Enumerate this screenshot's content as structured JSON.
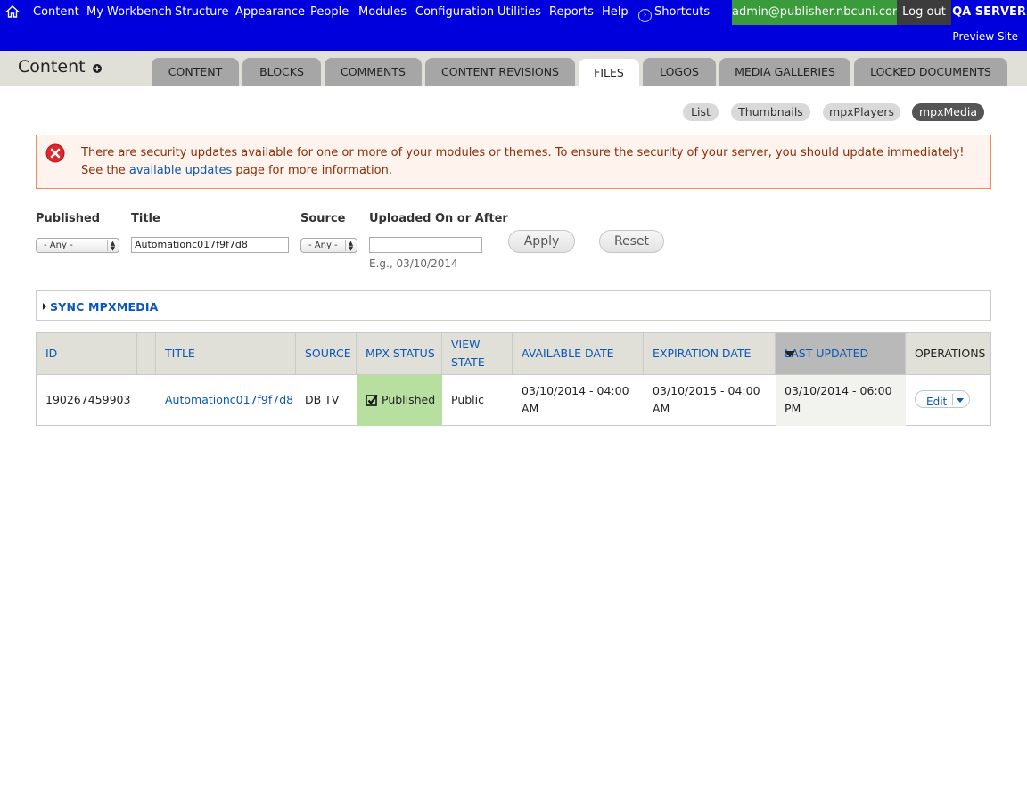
{
  "toolbar": {
    "menu": [
      "Content",
      "My Workbench",
      "Structure",
      "Appearance",
      "People",
      "Modules",
      "Configuration",
      "Utilities",
      "Reports",
      "Help"
    ],
    "shortcuts_label": "Shortcuts",
    "user": "admin@publisher.nbcuni.com",
    "logout": "Log out",
    "server": "QA SERVER",
    "preview_site": "Preview Site"
  },
  "page": {
    "title": "Content",
    "tabs": [
      "Content",
      "Blocks",
      "Comments",
      "Content Revisions",
      "Files",
      "Logos",
      "Media Galleries",
      "Locked Documents"
    ],
    "active_tab": "Files",
    "subtabs": [
      "List",
      "Thumbnails",
      "mpxPlayers",
      "mpxMedia"
    ],
    "active_subtab": "mpxMedia"
  },
  "message": {
    "text_before": "There are security updates available for one or more of your modules or themes. To ensure the security of your server, you should update immediately! See the ",
    "link": "available updates",
    "text_after": " page for more information."
  },
  "filters": {
    "published_label": "Published",
    "published_value": "- Any -",
    "title_label": "Title",
    "title_value": "Automationc017f9f7d8",
    "source_label": "Source",
    "source_value": "- Any -",
    "uploaded_label": "Uploaded On or After",
    "uploaded_value": "",
    "uploaded_hint": "E.g., 03/10/2014",
    "apply": "Apply",
    "reset": "Reset"
  },
  "sync": {
    "label": "SYNC MPXMEDIA"
  },
  "table": {
    "headers": {
      "id": "ID",
      "title": "Title",
      "source": "Source",
      "mpx_status": "MPX Status",
      "view_state_1": "View",
      "view_state_2": "State",
      "available_date": "Available Date",
      "expiration_date": "Expiration Date",
      "last_updated": "Last Updated",
      "operations": "Operations"
    },
    "rows": [
      {
        "id": "190267459903",
        "title": "Automationc017f9f7d8",
        "source": "DB TV",
        "mpx_status": "Published",
        "view_state": "Public",
        "available_1": "03/10/2014 - 04:00",
        "available_2": "AM",
        "expiration_1": "03/10/2015 - 04:00",
        "expiration_2": "AM",
        "updated_1": "03/10/2014 - 06:00",
        "updated_2": "PM",
        "operation": "Edit"
      }
    ]
  },
  "icons": [
    "home-icon",
    "shortcuts-icon",
    "add-icon",
    "error-icon",
    "checkbox-checked-icon",
    "sort-desc-icon",
    "dropdown-caret-icon"
  ],
  "colors": {
    "toolbar": "#0000dd",
    "user_pill": "#3a9b3a",
    "link": "#0b57b7",
    "status_published": "#b6dfa0",
    "error_bg": "#fef3ed",
    "error_border": "#ec8c5a"
  }
}
